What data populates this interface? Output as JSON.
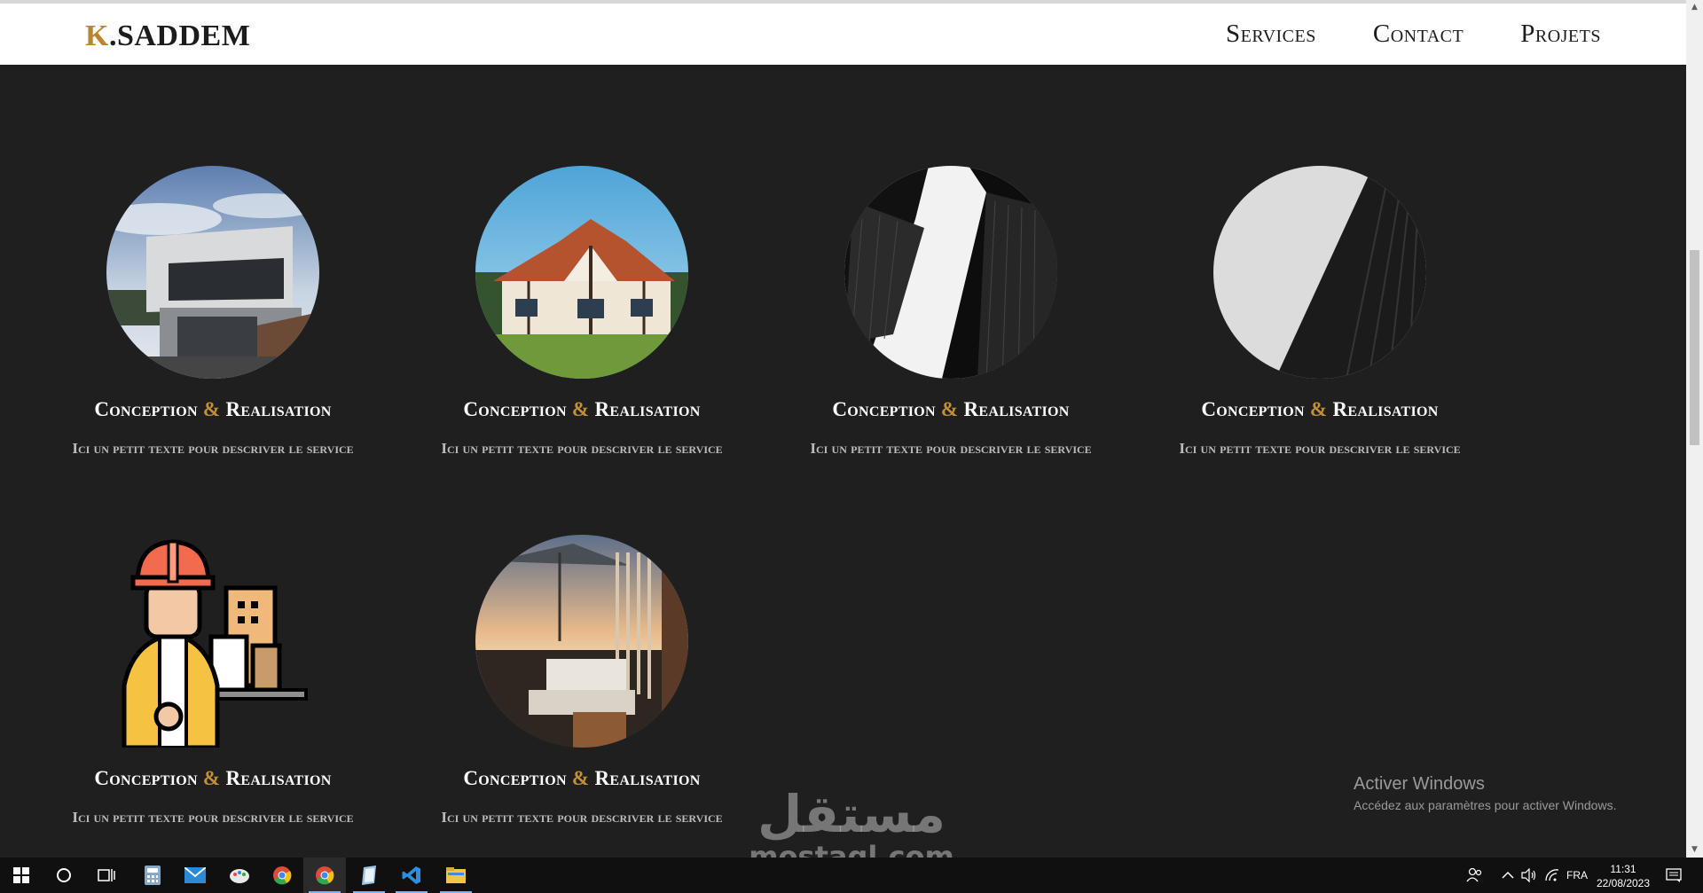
{
  "header": {
    "logo_initial": "K",
    "logo_rest": ".SADDEM",
    "nav": [
      "Services",
      "Contact",
      "Projets"
    ]
  },
  "services": [
    {
      "title_a": "Conception",
      "amp": "&",
      "title_b": "Realisation",
      "desc": "Ici un petit texte pour descriver le service",
      "image": "modern-house-photo"
    },
    {
      "title_a": "Conception",
      "amp": "&",
      "title_b": "Realisation",
      "desc": "Ici un petit texte pour descriver le service",
      "image": "tudor-house-photo"
    },
    {
      "title_a": "Conception",
      "amp": "&",
      "title_b": "Realisation",
      "desc": "Ici un petit texte pour descriver le service",
      "image": "skyscrapers-photo"
    },
    {
      "title_a": "Conception",
      "amp": "&",
      "title_b": "Realisation",
      "desc": "Ici un petit texte pour descriver le service",
      "image": "facade-detail-photo"
    },
    {
      "title_a": "Conception",
      "amp": "&",
      "title_b": "Realisation",
      "desc": "Ici un petit texte pour descriver le service",
      "image": "engineer-illustration"
    },
    {
      "title_a": "Conception",
      "amp": "&",
      "title_b": "Realisation",
      "desc": "Ici un petit texte pour descriver le service",
      "image": "terrace-photo"
    }
  ],
  "watermarks": {
    "activate_title": "Activer Windows",
    "activate_sub": "Accédez aux paramètres pour activer Windows.",
    "mostaql_ar": "مستقل",
    "mostaql_en": "mostaql.com"
  },
  "taskbar": {
    "lang": "FRA",
    "time": "11:31",
    "date": "22/08/2023"
  },
  "colors": {
    "background": "#1f1f1f",
    "accent": "#c5902f",
    "header_bg": "#ffffff"
  }
}
